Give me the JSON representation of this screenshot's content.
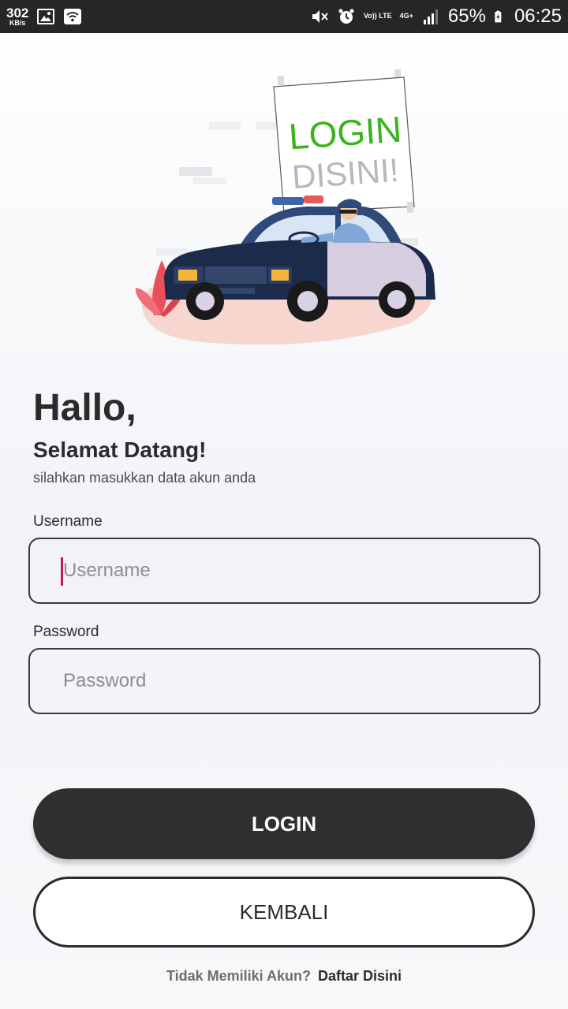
{
  "status_bar": {
    "net_speed_value": "302",
    "net_speed_unit": "KB/s",
    "volte_label": "Vo)) LTE",
    "network_label": "4G+",
    "battery": "65%",
    "time": "06:25",
    "icons": [
      "gallery-icon",
      "wifi-icon",
      "mute-icon",
      "alarm-icon",
      "signal-icon",
      "battery-icon"
    ]
  },
  "hero": {
    "sign_line1": "LOGIN",
    "sign_line2": "DISINI!",
    "colors": {
      "sign_green": "#3cb21f",
      "sign_gray": "#b8b8b8",
      "car_blue": "#2f4a78",
      "car_dark": "#1d2b4a",
      "ground": "#f7d6cf",
      "plant": "#e8505b"
    }
  },
  "greeting": {
    "title": "Hallo,",
    "subtitle": "Selamat Datang!",
    "hint": "silahkan masukkan data akun anda"
  },
  "form": {
    "username_label": "Username",
    "username_placeholder": "Username",
    "username_value": "",
    "password_label": "Password",
    "password_placeholder": "Password",
    "password_value": ""
  },
  "actions": {
    "login_label": "LOGIN",
    "back_label": "KEMBALI"
  },
  "footer": {
    "question": "Tidak Memiliki Akun?",
    "signup_link": "Daftar Disini"
  },
  "colors": {
    "primary_dark": "#2f2f31",
    "cursor": "#c2185b",
    "background": "#f2f3f7"
  }
}
